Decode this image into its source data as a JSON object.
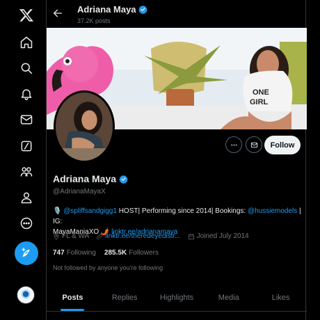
{
  "nav": {
    "items": [
      "home",
      "explore",
      "notifications",
      "messages",
      "grok",
      "communities",
      "profile",
      "more"
    ]
  },
  "header": {
    "name": "Adriana Maya",
    "post_count": "37.2K posts"
  },
  "profile": {
    "name": "Adriana Maya",
    "handle": "@AdrianaMayaX",
    "bio": {
      "mention1": "@spliffsandgigg1",
      "text1": " HOST| Performing since 2014| Bookings: ",
      "mention2": "@hussiemodels",
      "text2": " | IG:",
      "text3": "MayaManiaXO 🌶️ ",
      "link": "linktr.ee/adrianamaya"
    },
    "location": "FL & WA",
    "website": "linktr.ee/theredeyedistr...",
    "joined": "Joined July 2014",
    "following_count": "747",
    "following_label": "Following",
    "followers_count": "285.5K",
    "followers_label": "Followers",
    "not_followed_text": "Not followed by anyone you’re following",
    "follow_label": "Follow"
  },
  "tabs": {
    "posts": "Posts",
    "replies": "Replies",
    "highlights": "Highlights",
    "media": "Media",
    "likes": "Likes"
  },
  "colors": {
    "accent": "#1d9bf0",
    "background": "#000000",
    "muted": "#71767b"
  }
}
